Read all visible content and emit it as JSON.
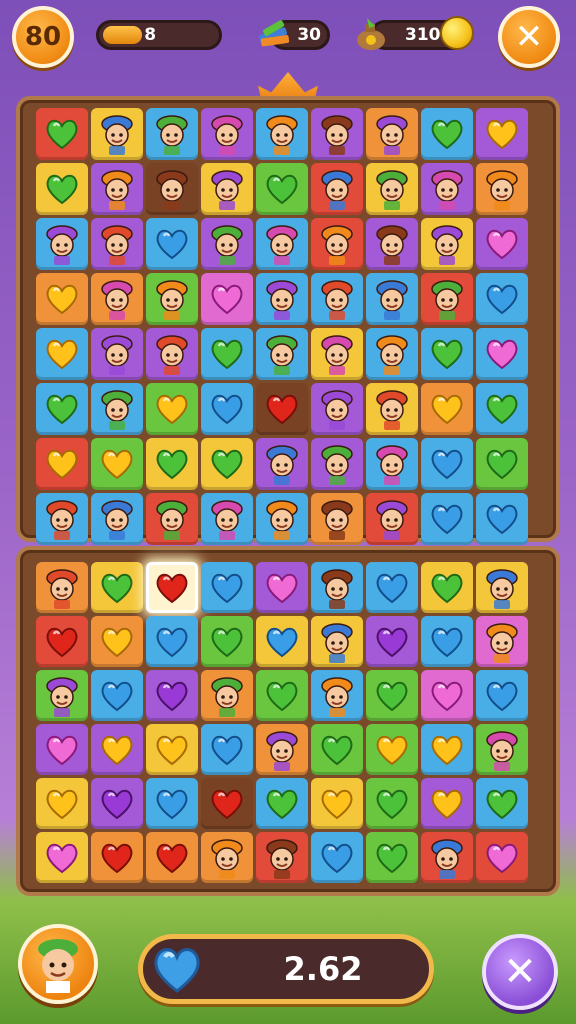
{
  "hud": {
    "level": "80",
    "moves_text": "8",
    "moves_progress": 0.35,
    "books_count": "30",
    "coins_count": "310",
    "close_icon": "close-icon"
  },
  "footer": {
    "score_value": "2.62",
    "avatar_icon": "character-avatar",
    "cancel_icon": "cancel-icon"
  },
  "colors": {
    "red": "#e0362a",
    "yellow": "#f6c22e",
    "blue": "#3fb0ea",
    "green": "#5cc23a",
    "purple": "#a44fd6",
    "orange": "#f08a24",
    "pink": "#e25bc9",
    "brown": "#6b3a1e"
  },
  "board_top": [
    [
      "red:green-gem",
      "yellow:char",
      "blue:char",
      "purple:char",
      "blue:char",
      "purple:char",
      "orange:char",
      "blue:green-gem",
      "purple:yellow-gem"
    ],
    [
      "yellow:green-gem",
      "purple:char",
      "brown:char",
      "yellow:char",
      "green:green-gem",
      "red:char",
      "yellow:char",
      "purple:char",
      "orange:char"
    ],
    [
      "blue:char",
      "purple:char",
      "blue:blue-gem",
      "purple:char",
      "blue:char",
      "red:char",
      "purple:char",
      "yellow:char",
      "purple:pink-gem"
    ],
    [
      "orange:yellow-gem",
      "orange:char",
      "green:char",
      "pink:pink-gem",
      "blue:char",
      "blue:char",
      "blue:char",
      "red:char",
      "blue:blue-gem"
    ],
    [
      "blue:yellow-gem",
      "purple:char",
      "purple:char",
      "blue:green-gem",
      "blue:char",
      "yellow:char",
      "blue:char",
      "blue:green-gem",
      "blue:pink-gem"
    ],
    [
      "blue:green-gem",
      "blue:char",
      "green:yellow-gem",
      "blue:blue-gem",
      "brown:red-gem",
      "purple:char",
      "yellow:char",
      "orange:yellow-gem",
      "blue:green-gem"
    ],
    [
      "red:yellow-gem",
      "green:yellow-gem",
      "yellow:green-gem",
      "yellow:green-gem",
      "purple:char",
      "purple:char",
      "blue:char",
      "blue:blue-gem",
      "green:green-gem"
    ],
    [
      "blue:char",
      "blue:char",
      "red:char",
      "blue:char",
      "blue:char",
      "orange:char",
      "red:char",
      "blue:blue-gem",
      "blue:blue-gem"
    ]
  ],
  "board_bottom": [
    [
      "orange:char",
      "yellow:green-gem",
      "white:red-gem",
      "blue:blue-gem",
      "purple:pink-gem",
      "blue:char",
      "blue:blue-gem",
      "yellow:green-gem",
      "yellow:char"
    ],
    [
      "red:red-gem",
      "orange:yellow-gem",
      "blue:blue-gem",
      "green:green-gem",
      "yellow:blue-gem",
      "yellow:char",
      "purple:purple-gem",
      "blue:blue-gem",
      "pink:char"
    ],
    [
      "green:char",
      "blue:blue-gem",
      "purple:purple-gem",
      "orange:char",
      "green:green-gem",
      "blue:char",
      "green:green-gem",
      "pink:pink-gem",
      "blue:blue-gem"
    ],
    [
      "purple:pink-gem",
      "purple:yellow-gem",
      "yellow:yellow-gem",
      "blue:blue-gem",
      "orange:char",
      "green:green-gem",
      "green:yellow-gem",
      "blue:yellow-gem",
      "green:char"
    ],
    [
      "yellow:yellow-gem",
      "purple:purple-gem",
      "blue:blue-gem",
      "brown:red-gem",
      "blue:green-gem",
      "yellow:yellow-gem",
      "green:green-gem",
      "purple:yellow-gem",
      "blue:green-gem"
    ],
    [
      "yellow:pink-gem",
      "orange:red-gem",
      "orange:red-gem",
      "orange:char",
      "red:char",
      "blue:blue-gem",
      "green:green-gem",
      "red:char",
      "red:pink-gem"
    ]
  ]
}
